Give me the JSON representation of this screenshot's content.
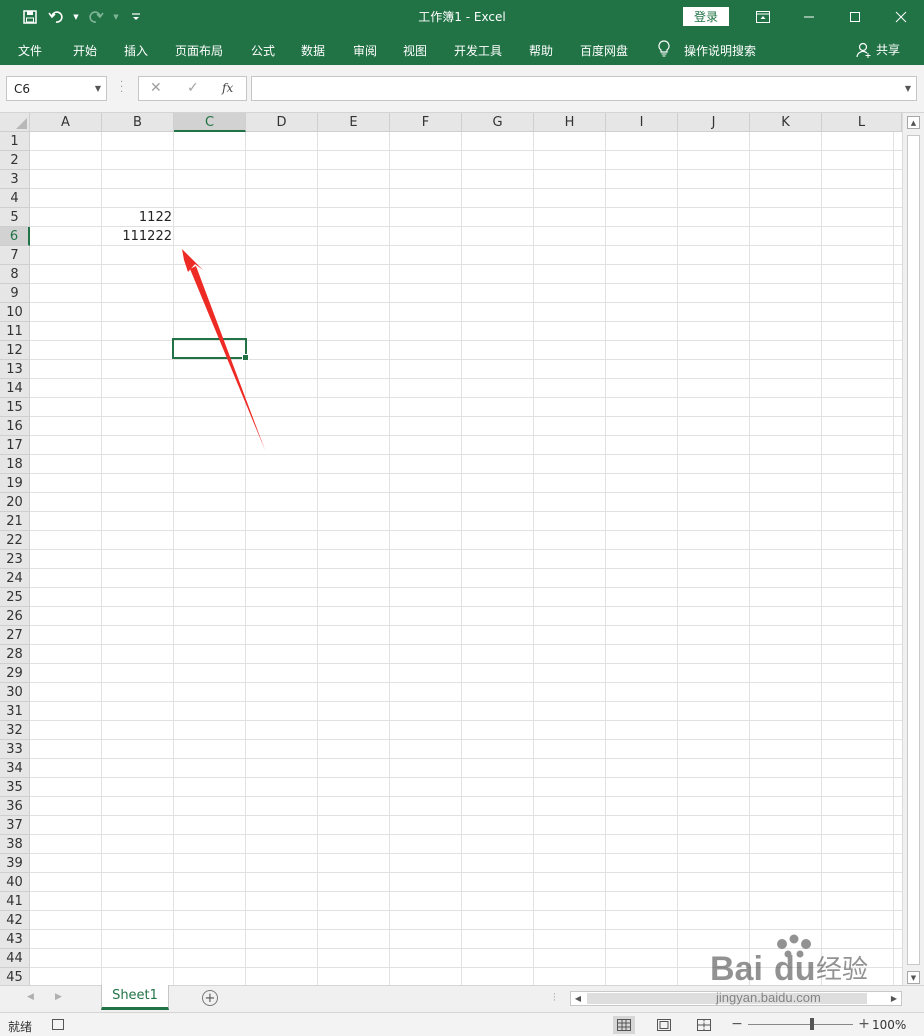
{
  "window": {
    "title": "工作簿1  -  Excel",
    "login_label": "登录",
    "qat_icons": [
      "save-icon",
      "undo-icon",
      "redo-icon",
      "customize-icon"
    ]
  },
  "ribbon": {
    "tabs": [
      "文件",
      "开始",
      "插入",
      "页面布局",
      "公式",
      "数据",
      "审阅",
      "视图",
      "开发工具",
      "帮助",
      "百度网盘"
    ],
    "tell_me": "操作说明搜索",
    "share_label": "共享"
  },
  "formula_bar": {
    "name_box": "C6",
    "cancel_glyph": "✕",
    "enter_glyph": "✓",
    "fx_glyph": "fx",
    "formula_value": ""
  },
  "grid": {
    "columns": [
      "A",
      "B",
      "C",
      "D",
      "E",
      "F",
      "G",
      "H",
      "I",
      "J",
      "K",
      "L"
    ],
    "rows": [
      "1",
      "2",
      "3",
      "4",
      "5",
      "6",
      "7",
      "8",
      "9",
      "10",
      "11",
      "12",
      "13",
      "14",
      "15",
      "16",
      "17",
      "18",
      "19",
      "20",
      "21",
      "22",
      "23",
      "24",
      "25",
      "26",
      "27",
      "28",
      "29",
      "30",
      "31",
      "32",
      "33",
      "34",
      "35",
      "36",
      "37",
      "38",
      "39",
      "40",
      "41",
      "42",
      "43",
      "44",
      "45"
    ],
    "active_column": "C",
    "active_row": "6",
    "cells": [
      {
        "ref": "B5",
        "value": "1122"
      },
      {
        "ref": "B6",
        "value": "111222"
      }
    ]
  },
  "sheets": {
    "tabs": [
      "Sheet1"
    ],
    "active": "Sheet1",
    "add_glyph": "+"
  },
  "status": {
    "ready": "就绪",
    "zoom": "100%",
    "zoom_minus": "−",
    "zoom_plus": "+"
  },
  "watermark": {
    "brand": "Bai",
    "brand2": "du",
    "cn": "经验",
    "url": "jingyan.baidu.com"
  },
  "colors": {
    "accent": "#217346",
    "arrow": "#ee2a24"
  }
}
